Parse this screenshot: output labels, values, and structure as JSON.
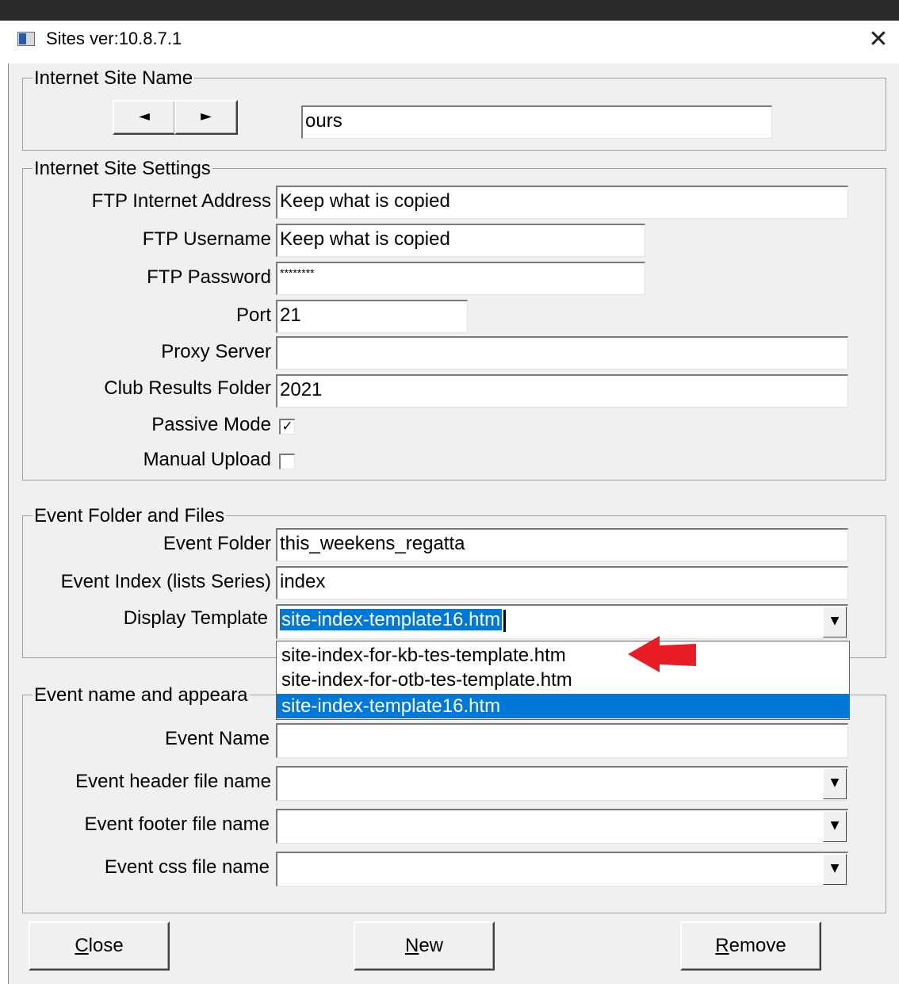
{
  "window": {
    "title": "Sites ver:10.8.7.1"
  },
  "site_name": {
    "group_label": "Internet Site Name",
    "prev_symbol": "◄",
    "next_symbol": "►",
    "value": "ours"
  },
  "settings": {
    "group_label": "Internet Site Settings",
    "ftp_address_label": "FTP Internet Address",
    "ftp_address_value": "Keep what is copied",
    "ftp_username_label": "FTP Username",
    "ftp_username_value": "Keep what is copied",
    "ftp_password_label": "FTP Password",
    "ftp_password_value": "********",
    "port_label": "Port",
    "port_value": "21",
    "proxy_label": "Proxy Server",
    "proxy_value": "",
    "club_folder_label": "Club Results Folder",
    "club_folder_value": "2021",
    "passive_label": "Passive Mode",
    "passive_checked": true,
    "manual_label": "Manual Upload",
    "manual_checked": false
  },
  "event_files": {
    "group_label": "Event Folder and Files",
    "event_folder_label": "Event Folder",
    "event_folder_value": "this_weekens_regatta",
    "event_index_label": "Event Index (lists Series)",
    "event_index_value": "index",
    "display_template_label": "Display Template",
    "display_template_value": "site-index-template16.htm",
    "options": [
      "site-index-for-kb-tes-template.htm",
      "site-index-for-otb-tes-template.htm",
      "site-index-template16.htm"
    ]
  },
  "event_appearance": {
    "group_label": "Event name and appeara",
    "event_name_label": "Event Name",
    "event_name_value": "",
    "header_label": "Event header file name",
    "header_value": "",
    "footer_label": "Event footer file name",
    "footer_value": "",
    "css_label": "Event css file name",
    "css_value": ""
  },
  "buttons": {
    "close_mnemonic": "C",
    "close_rest": "lose",
    "new_mnemonic": "N",
    "new_rest": "ew",
    "remove_mnemonic": "R",
    "remove_rest": "emove"
  },
  "colors": {
    "selection": "#0078d7",
    "annotation_arrow": "#e81c24"
  }
}
